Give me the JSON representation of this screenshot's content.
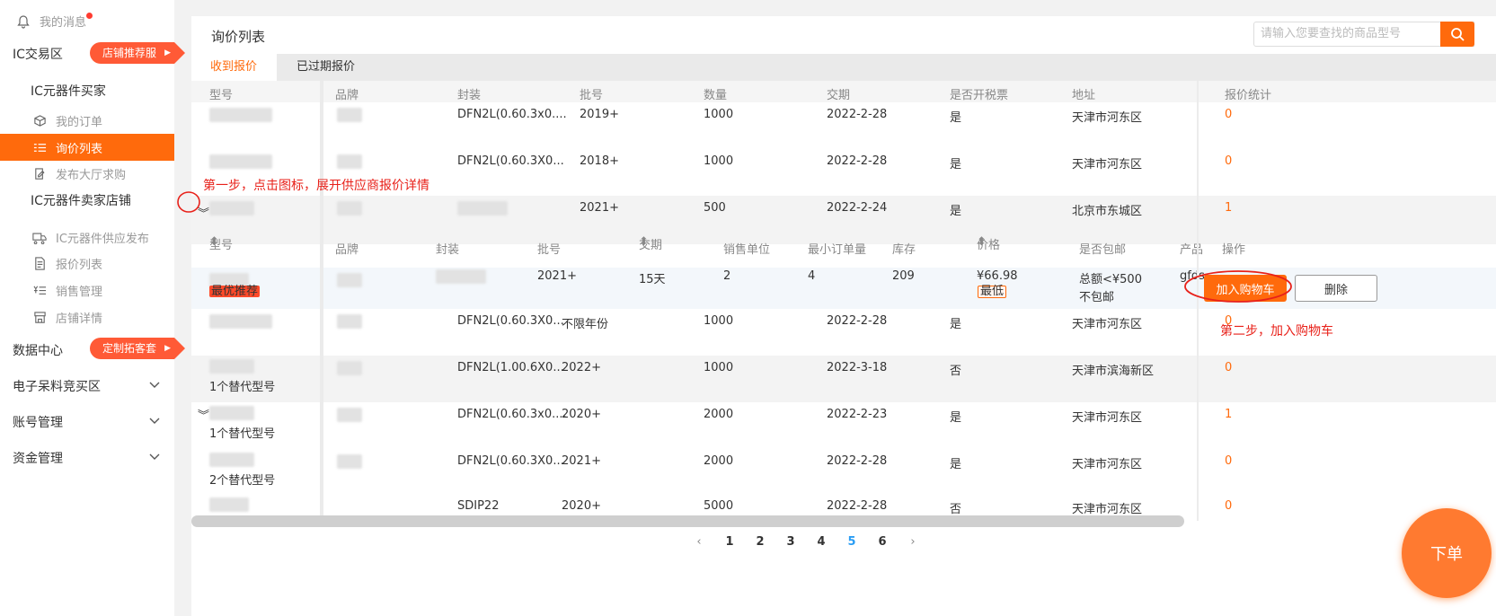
{
  "sidebar": {
    "messages": "我的消息",
    "ic_trade": "IC交易区",
    "ic_trade_tag": "店铺推荐服务",
    "buyer_header": "IC元器件买家",
    "buyer_items": [
      "我的订单",
      "询价列表",
      "发布大厅求购"
    ],
    "seller_header": "IC元器件卖家店铺",
    "seller_items": [
      "IC元器件供应发布",
      "报价列表",
      "销售管理",
      "店铺详情"
    ],
    "data_center": "数据中心",
    "data_center_tag": "定制拓客套餐",
    "collapsed": [
      "电子呆料竞买区",
      "账号管理",
      "资金管理"
    ]
  },
  "page": {
    "title": "询价列表",
    "search_placeholder": "请输入您要查找的商品型号",
    "tabs": [
      "收到报价",
      "已过期报价"
    ]
  },
  "table": {
    "headers": [
      "型号",
      "品牌",
      "封装",
      "批号",
      "数量",
      "交期",
      "是否开税票",
      "地址",
      "报价统计"
    ],
    "rows": [
      {
        "package": "DFN2L(0.60.3x0....",
        "batch": "2019+",
        "qty": "1000",
        "date": "2022-2-28",
        "invoice": "是",
        "addr": "天津市河东区",
        "quotes": "0",
        "sub": ""
      },
      {
        "package": "DFN2L(0.60.3X0...",
        "batch": "2018+",
        "qty": "1000",
        "date": "2022-2-28",
        "invoice": "是",
        "addr": "天津市河东区",
        "quotes": "0",
        "sub": ""
      },
      {
        "package": "",
        "batch": "2021+",
        "qty": "500",
        "date": "2022-2-24",
        "invoice": "是",
        "addr": "北京市东城区",
        "quotes": "1",
        "sub": ""
      },
      {
        "package": "DFN2L(0.60.3X0...",
        "batch": "不限年份",
        "qty": "1000",
        "date": "2022-2-28",
        "invoice": "是",
        "addr": "天津市河东区",
        "quotes": "0",
        "sub": ""
      },
      {
        "package": "DFN2L(1.00.6X0...",
        "batch": "2022+",
        "qty": "1000",
        "date": "2022-3-18",
        "invoice": "否",
        "addr": "天津市滨海新区",
        "quotes": "0",
        "sub": "1个替代型号"
      },
      {
        "package": "DFN2L(0.60.3x0....",
        "batch": "2020+",
        "qty": "2000",
        "date": "2022-2-23",
        "invoice": "是",
        "addr": "天津市河东区",
        "quotes": "1",
        "sub": "1个替代型号"
      },
      {
        "package": "DFN2L(0.60.3X0...",
        "batch": "2021+",
        "qty": "2000",
        "date": "2022-2-28",
        "invoice": "是",
        "addr": "天津市河东区",
        "quotes": "0",
        "sub": "2个替代型号"
      },
      {
        "package": "SDIP22",
        "batch": "2020+",
        "qty": "5000",
        "date": "2022-2-28",
        "invoice": "否",
        "addr": "天津市河东区",
        "quotes": "0",
        "sub": ""
      }
    ]
  },
  "expanded": {
    "headers": [
      "型号",
      "品牌",
      "封装",
      "批号",
      "交期",
      "销售单位",
      "最小订单量",
      "库存",
      "价格",
      "是否包邮",
      "产品",
      "操作"
    ],
    "row": {
      "badge": "最优推荐",
      "batch": "2021+",
      "lead": "15天",
      "unit": "2",
      "moq": "4",
      "stock": "209",
      "price": "¥66.98",
      "price_badge": "最低",
      "shipping1": "总额<¥500",
      "shipping2": "不包邮",
      "product": "gfds",
      "cart_btn": "加入购物车",
      "del_btn": "删除"
    }
  },
  "annotations": {
    "step1": "第一步，点击图标，展开供应商报价详情",
    "step2": "第二步，加入购物车"
  },
  "pagination": {
    "pages": [
      "1",
      "2",
      "3",
      "4",
      "5",
      "6"
    ],
    "current": "5"
  },
  "fab": "下单",
  "colors": {
    "accent": "#ff6a0c",
    "annotation": "#e8211a",
    "current_page": "#2a9df4"
  }
}
